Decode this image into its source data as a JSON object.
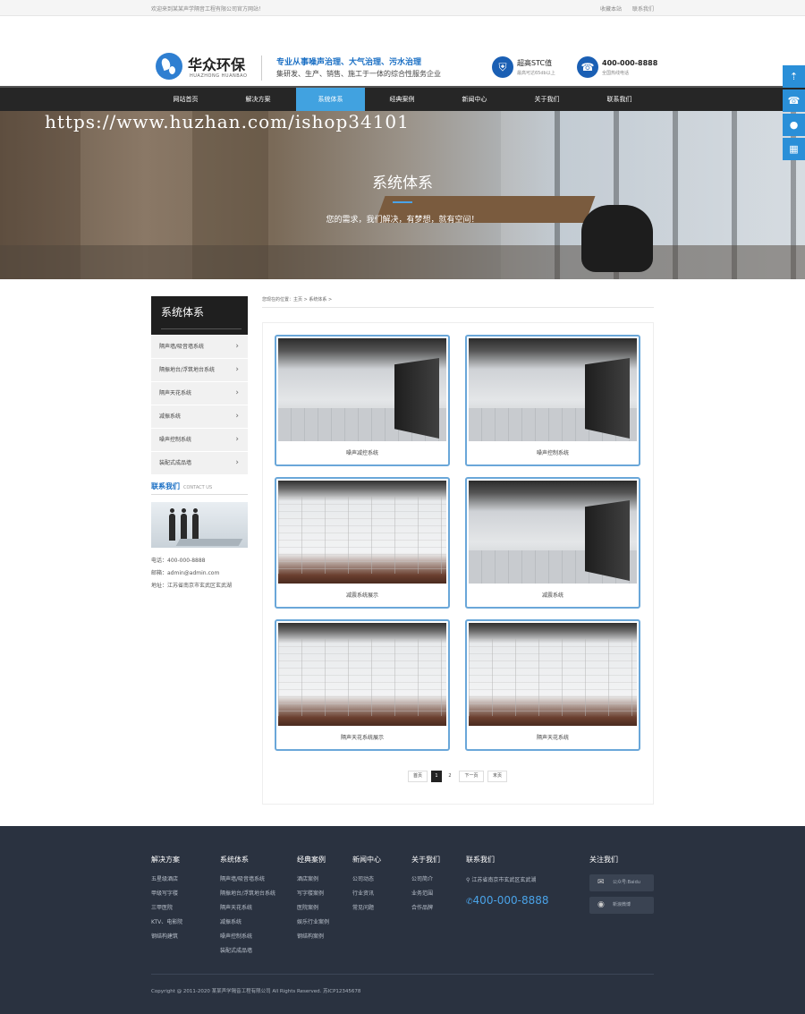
{
  "topbar": {
    "welcome": "欢迎来到某某声学隔音工程有限公司官方网站！",
    "links": [
      "收藏本站",
      "联系我们"
    ]
  },
  "header": {
    "logo_cn": "华众环保",
    "logo_en": "HUAZHONG HUANBAO",
    "slogan": "专业从事噪声治理、大气治理、污水治理",
    "tagline": "集研发、生产、销售、施工于一体的综合性服务企业",
    "badge1_title": "超高STC值",
    "badge1_sub": "最高可达65db以上",
    "badge2_title": "400-000-8888",
    "badge2_sub": "全国热线电话"
  },
  "nav": [
    "网站首页",
    "解决方案",
    "系统体系",
    "经典案例",
    "新闻中心",
    "关于我们",
    "联系我们"
  ],
  "nav_active": 2,
  "banner": {
    "watermark": "https://www.huzhan.com/ishop34101",
    "title": "系统体系",
    "subtitle": "您的需求，我们解决，有梦想，就有空间！"
  },
  "sidebar": {
    "title": "系统体系",
    "items": [
      "隔声墙/吸音墙系统",
      "隔振地台/浮筑地台系统",
      "隔声天花系统",
      "减振系统",
      "噪声控制系统",
      "装配式成品墙"
    ],
    "contact_title": "联系我们",
    "contact_en": "CONTACT US",
    "phone": "电话：400-000-8888",
    "email": "邮箱：admin@admin.com",
    "address": "地址：江苏省南京市玄武区玄武湖"
  },
  "breadcrumb": "您现在的位置：主页 > 系统体系 >",
  "products": [
    {
      "caption": "噪声减控系统",
      "style": "hall"
    },
    {
      "caption": "噪声控制系统",
      "style": "hall"
    },
    {
      "caption": "减震系统展示",
      "style": "wall"
    },
    {
      "caption": "减震系统",
      "style": "hall"
    },
    {
      "caption": "隔声天花系统展示",
      "style": "wall"
    },
    {
      "caption": "隔声天花系统",
      "style": "wall"
    }
  ],
  "pagination": [
    "首页",
    "1",
    "2",
    "下一页",
    "末页"
  ],
  "pagination_active": 1,
  "footer": {
    "cols": [
      {
        "title": "解决方案",
        "links": [
          "五星级酒店",
          "甲级写字楼",
          "三甲医院",
          "KTV、电影院",
          "钢结构建筑"
        ]
      },
      {
        "title": "系统体系",
        "links": [
          "隔声墙/吸音墙系统",
          "隔振地台/浮筑地台系统",
          "隔声天花系统",
          "减振系统",
          "噪声控制系统",
          "装配式成品墙"
        ]
      },
      {
        "title": "经典案例",
        "links": [
          "酒店案例",
          "写字楼案例",
          "医院案例",
          "娱乐行业案例",
          "钢结构案例"
        ]
      },
      {
        "title": "新闻中心",
        "links": [
          "公司动态",
          "行业资讯",
          "常见问题"
        ]
      },
      {
        "title": "关于我们",
        "links": [
          "公司简介",
          "业务范围",
          "合作品牌"
        ]
      }
    ],
    "contact_title": "联系我们",
    "address": "江苏省南京市玄武区玄武湖",
    "phone": "400-000-8888",
    "follow_title": "关注我们",
    "wechat": "公众号:Baidu",
    "weibo": "新浪微博",
    "copyright": "Copyright @ 2011-2020 某某声学隔音工程有限公司 All Rights Reserved. 苏ICP12345678"
  }
}
